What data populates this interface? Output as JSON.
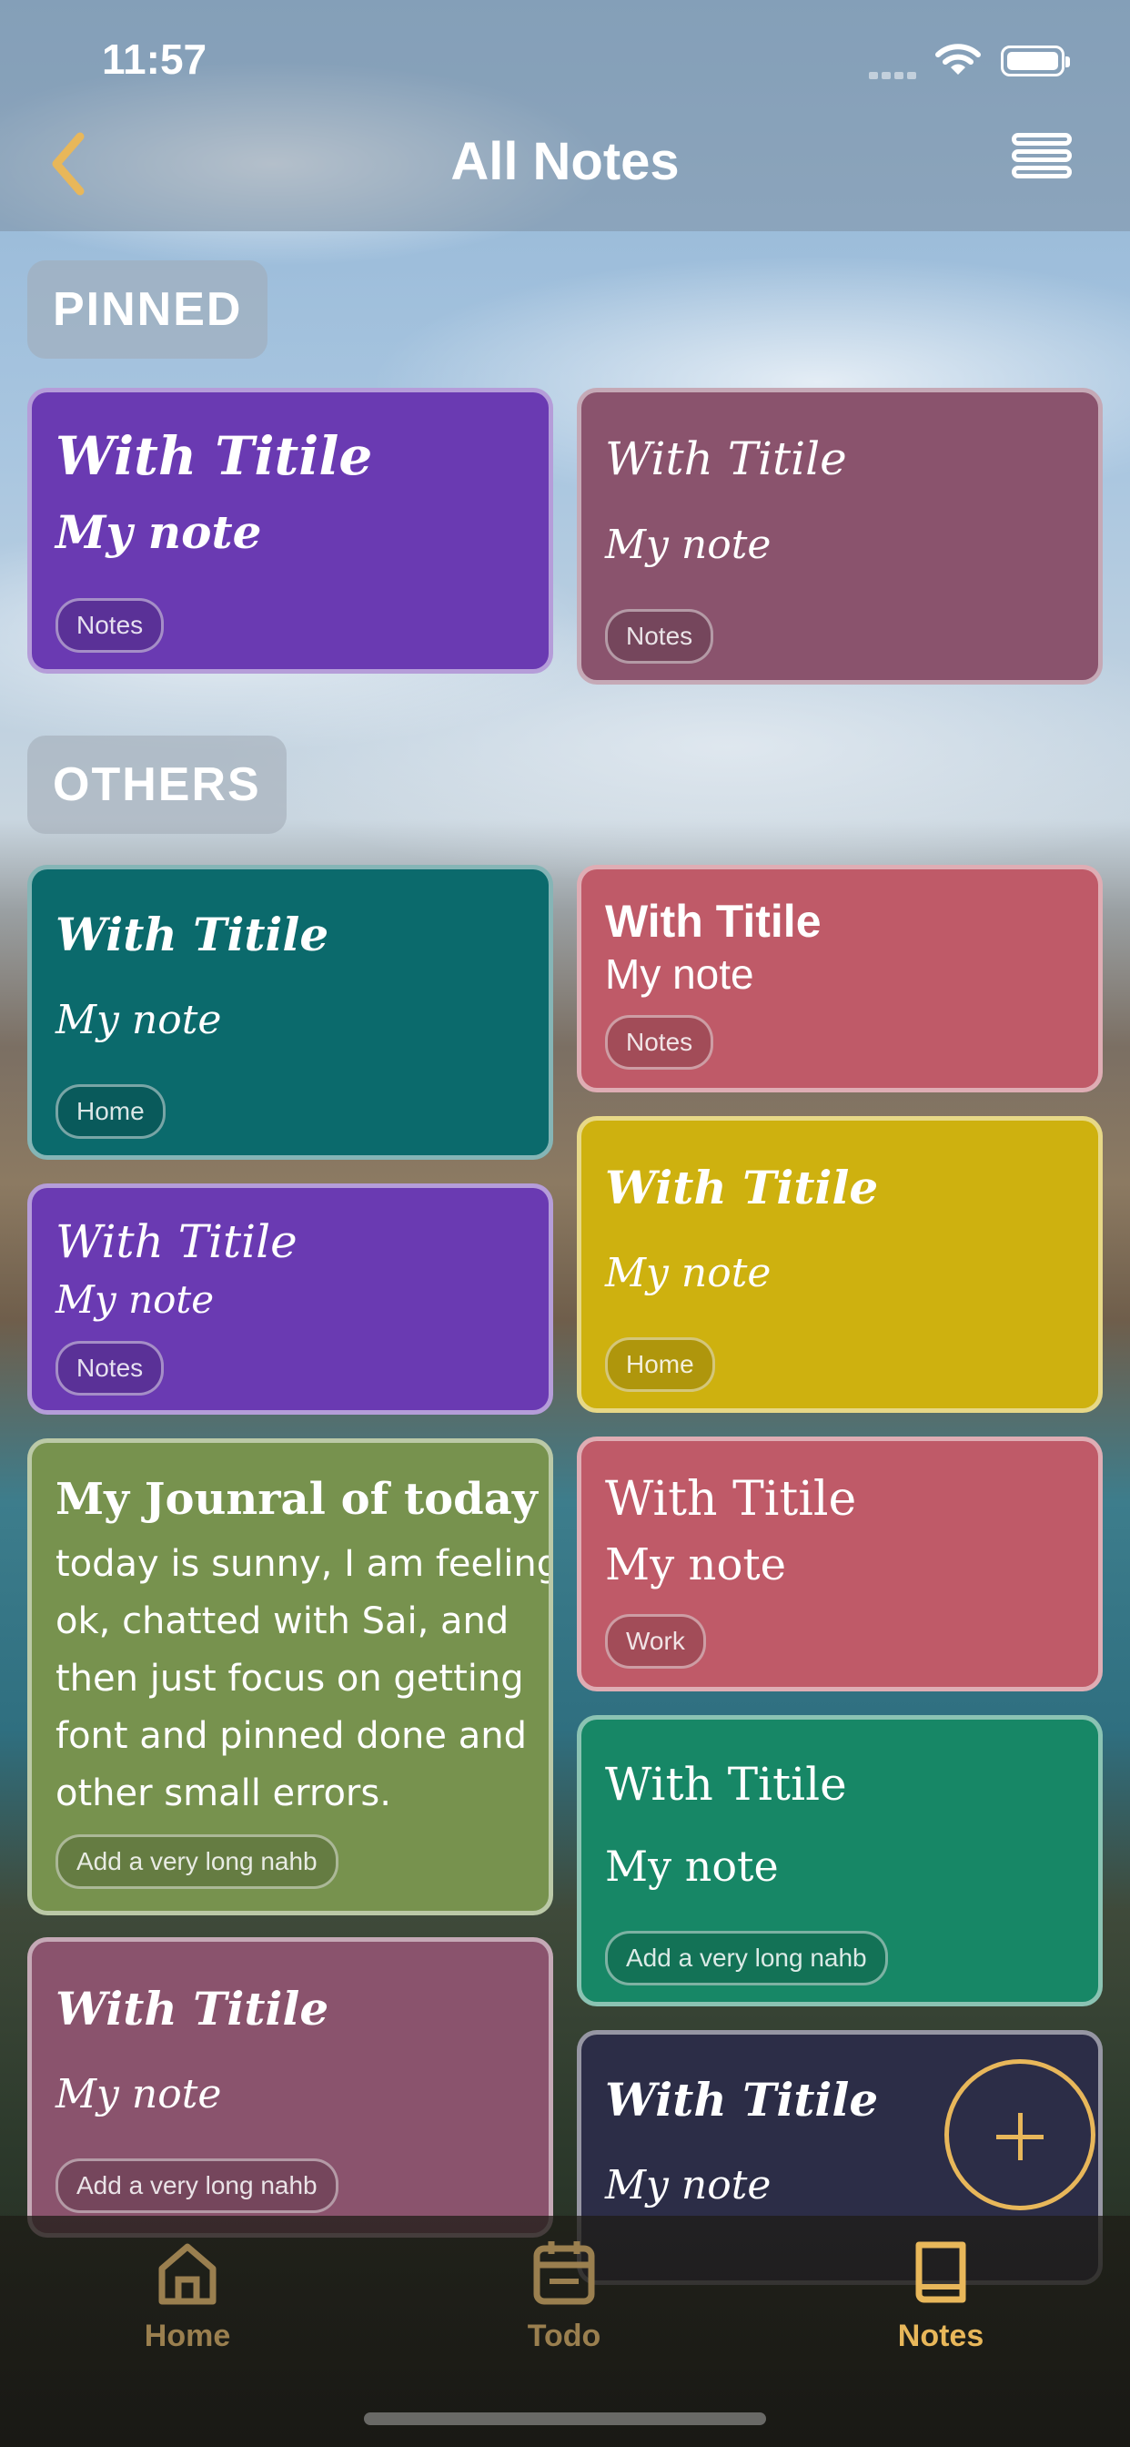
{
  "status_bar": {
    "time": "11:57"
  },
  "header": {
    "title": "All Notes"
  },
  "sections": {
    "pinned": "PINNED",
    "others": "OTHERS"
  },
  "notes": [
    {
      "title": "With Titile",
      "body": "My note",
      "tag": "Notes",
      "color": "#6a3ab2"
    },
    {
      "title": "With Titile",
      "body": "My note",
      "tag": "Notes",
      "color": "#8a536d"
    },
    {
      "title": "With Titile",
      "body": "My note",
      "tag": "Home",
      "color": "#0b6a6c"
    },
    {
      "title": "With Titile",
      "body": "My note",
      "tag": "Notes",
      "color": "#bf5a68"
    },
    {
      "title": "With Titile",
      "body": "My note",
      "tag": "Notes",
      "color": "#6a3ab2"
    },
    {
      "title": "With Titile",
      "body": "My note",
      "tag": "Home",
      "color": "#ceb10f"
    },
    {
      "title": "My Jounral of today",
      "body": "today is sunny, I am feeling ok, chatted with Sai, and then just focus on getting font and pinned done and other small errors.",
      "body_lines": [
        "today is sunny, I am feeling",
        "ok, chatted with Sai, and",
        "then just focus on getting",
        "font and pinned done and",
        "other small errors."
      ],
      "tag": "Add a very long nahb",
      "color": "#77924e"
    },
    {
      "title": "With Titile",
      "body": "My note",
      "tag": "Work",
      "color": "#bf5a68"
    },
    {
      "title": "With Titile",
      "body": "My note",
      "tag": "Add a very long nahb",
      "color": "#178766"
    },
    {
      "title": "With Titile",
      "body": "My note",
      "tag": "Add a very long nahb",
      "color": "#8a536d"
    },
    {
      "title": "With Titile",
      "body": "My note",
      "tag": "",
      "color": "#2c2d47"
    }
  ],
  "tabbar": {
    "items": [
      {
        "label": "Home",
        "icon": "home-icon",
        "active": false
      },
      {
        "label": "Todo",
        "icon": "calendar-icon",
        "active": false
      },
      {
        "label": "Notes",
        "icon": "book-icon",
        "active": true
      }
    ]
  },
  "colors": {
    "accent": "#e8b75a"
  }
}
